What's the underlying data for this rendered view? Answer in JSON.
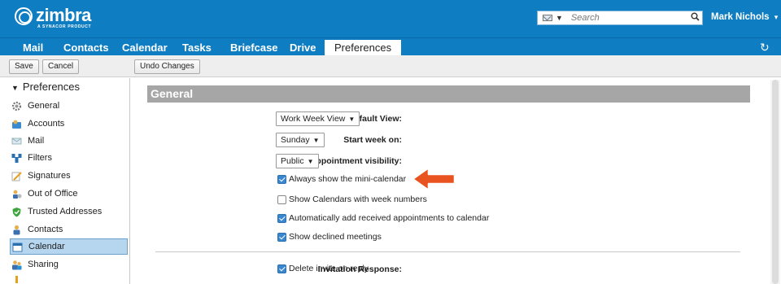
{
  "header": {
    "brand": "zimbra",
    "brand_sub": "A SYNACOR PRODUCT",
    "search_placeholder": "Search",
    "user": "Mark Nichols"
  },
  "tabs": [
    {
      "label": "Mail"
    },
    {
      "label": "Contacts"
    },
    {
      "label": "Calendar"
    },
    {
      "label": "Tasks"
    },
    {
      "label": "Briefcase"
    },
    {
      "label": "Drive"
    },
    {
      "label": "Preferences",
      "active": true
    }
  ],
  "toolbar": {
    "save": "Save",
    "cancel": "Cancel",
    "undo": "Undo Changes"
  },
  "sidebar": {
    "root": "Preferences",
    "items": [
      {
        "label": "General",
        "icon": "gear-icon"
      },
      {
        "label": "Accounts",
        "icon": "accounts-icon"
      },
      {
        "label": "Mail",
        "icon": "mail-icon"
      },
      {
        "label": "Filters",
        "icon": "filters-icon"
      },
      {
        "label": "Signatures",
        "icon": "signature-icon"
      },
      {
        "label": "Out of Office",
        "icon": "out-of-office-icon"
      },
      {
        "label": "Trusted Addresses",
        "icon": "shield-icon"
      },
      {
        "label": "Contacts",
        "icon": "contact-icon"
      },
      {
        "label": "Calendar",
        "icon": "calendar-icon",
        "selected": true
      },
      {
        "label": "Sharing",
        "icon": "sharing-icon"
      }
    ]
  },
  "main": {
    "section_title": "General",
    "default_view_label": "Default View:",
    "default_view_value": "Work Week View",
    "start_week_label": "Start week on:",
    "start_week_value": "Sunday",
    "visibility_label": "Default appointment visibility:",
    "visibility_value": "Public",
    "checks": [
      {
        "label": "Always show the mini-calendar",
        "checked": true
      },
      {
        "label": "Show Calendars with week numbers",
        "checked": false
      },
      {
        "label": "Automatically add received appointments to calendar",
        "checked": true
      },
      {
        "label": "Show declined meetings",
        "checked": true
      }
    ],
    "invitation_label": "Invitation Response:",
    "invitation_check": {
      "label": "Delete invite on reply",
      "checked": true
    }
  },
  "colors": {
    "brand_blue": "#0f7dc2",
    "arrow_orange": "#e8531f",
    "header_gray": "#a6a6a6",
    "selected_bg": "#b6d5ef"
  }
}
